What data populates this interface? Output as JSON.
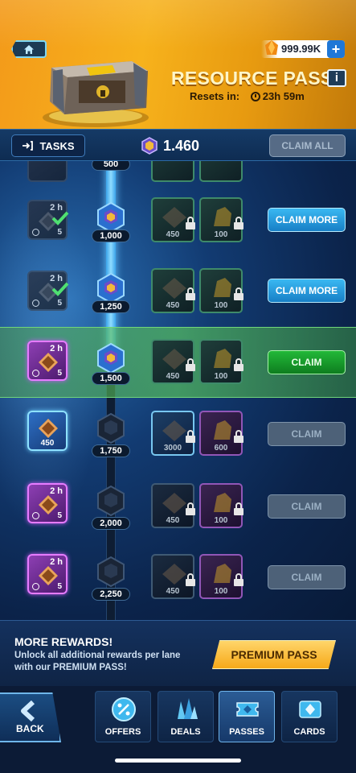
{
  "header": {
    "title": "RESOURCE PASS",
    "resets_label": "Resets in:",
    "resets_time": "23h 59m",
    "currency_amount": "999.99K",
    "currency_plus": "+",
    "info_label": "i",
    "home_icon": "home-icon",
    "chest_icon": "treasure-chest-icon"
  },
  "tasks_bar": {
    "tasks_label": "TASKS",
    "points": "1.460",
    "claim_all_label": "CLAIM ALL"
  },
  "milestones": [
    {
      "points": "500",
      "state": "partial"
    },
    {
      "points": "1,000",
      "task_hours": "2 h",
      "task_count": "5",
      "task_state": "done",
      "reward1_qty": "450",
      "reward2_qty": "100",
      "button": "CLAIM MORE"
    },
    {
      "points": "1,250",
      "task_hours": "2 h",
      "task_count": "5",
      "task_state": "done",
      "reward1_qty": "450",
      "reward2_qty": "100",
      "button": "CLAIM MORE"
    },
    {
      "points": "1,500",
      "task_hours": "2 h",
      "task_count": "5",
      "task_state": "active",
      "reward1_qty": "450",
      "reward2_qty": "100",
      "button": "CLAIM"
    },
    {
      "points": "1,750",
      "task_value": "450",
      "task_state": "reward",
      "reward1_qty": "3000",
      "reward2_qty": "600",
      "button": "CLAIM"
    },
    {
      "points": "2,000",
      "task_hours": "2 h",
      "task_count": "5",
      "task_state": "locked",
      "reward1_qty": "450",
      "reward2_qty": "100",
      "button": "CLAIM"
    },
    {
      "points": "2,250",
      "task_hours": "2 h",
      "task_count": "5",
      "task_state": "locked",
      "reward1_qty": "450",
      "reward2_qty": "100",
      "button": "CLAIM"
    }
  ],
  "premium": {
    "heading": "MORE REWARDS!",
    "description": "Unlock all additional rewards per lane with our PREMIUM PASS!",
    "button_label": "PREMIUM PASS"
  },
  "nav": {
    "back": "BACK",
    "items": [
      {
        "label": "OFFERS",
        "icon": "percent-badge-icon"
      },
      {
        "label": "DEALS",
        "icon": "crystals-icon"
      },
      {
        "label": "PASSES",
        "icon": "pass-ticket-icon"
      },
      {
        "label": "CARDS",
        "icon": "card-gem-icon"
      }
    ]
  },
  "colors": {
    "header_gold": "#f7b21c",
    "claim_more_blue": "#3ab8f2",
    "claim_green": "#22b838",
    "claim_disabled": "#4d6178",
    "highlight_row": "#5ac85a"
  }
}
